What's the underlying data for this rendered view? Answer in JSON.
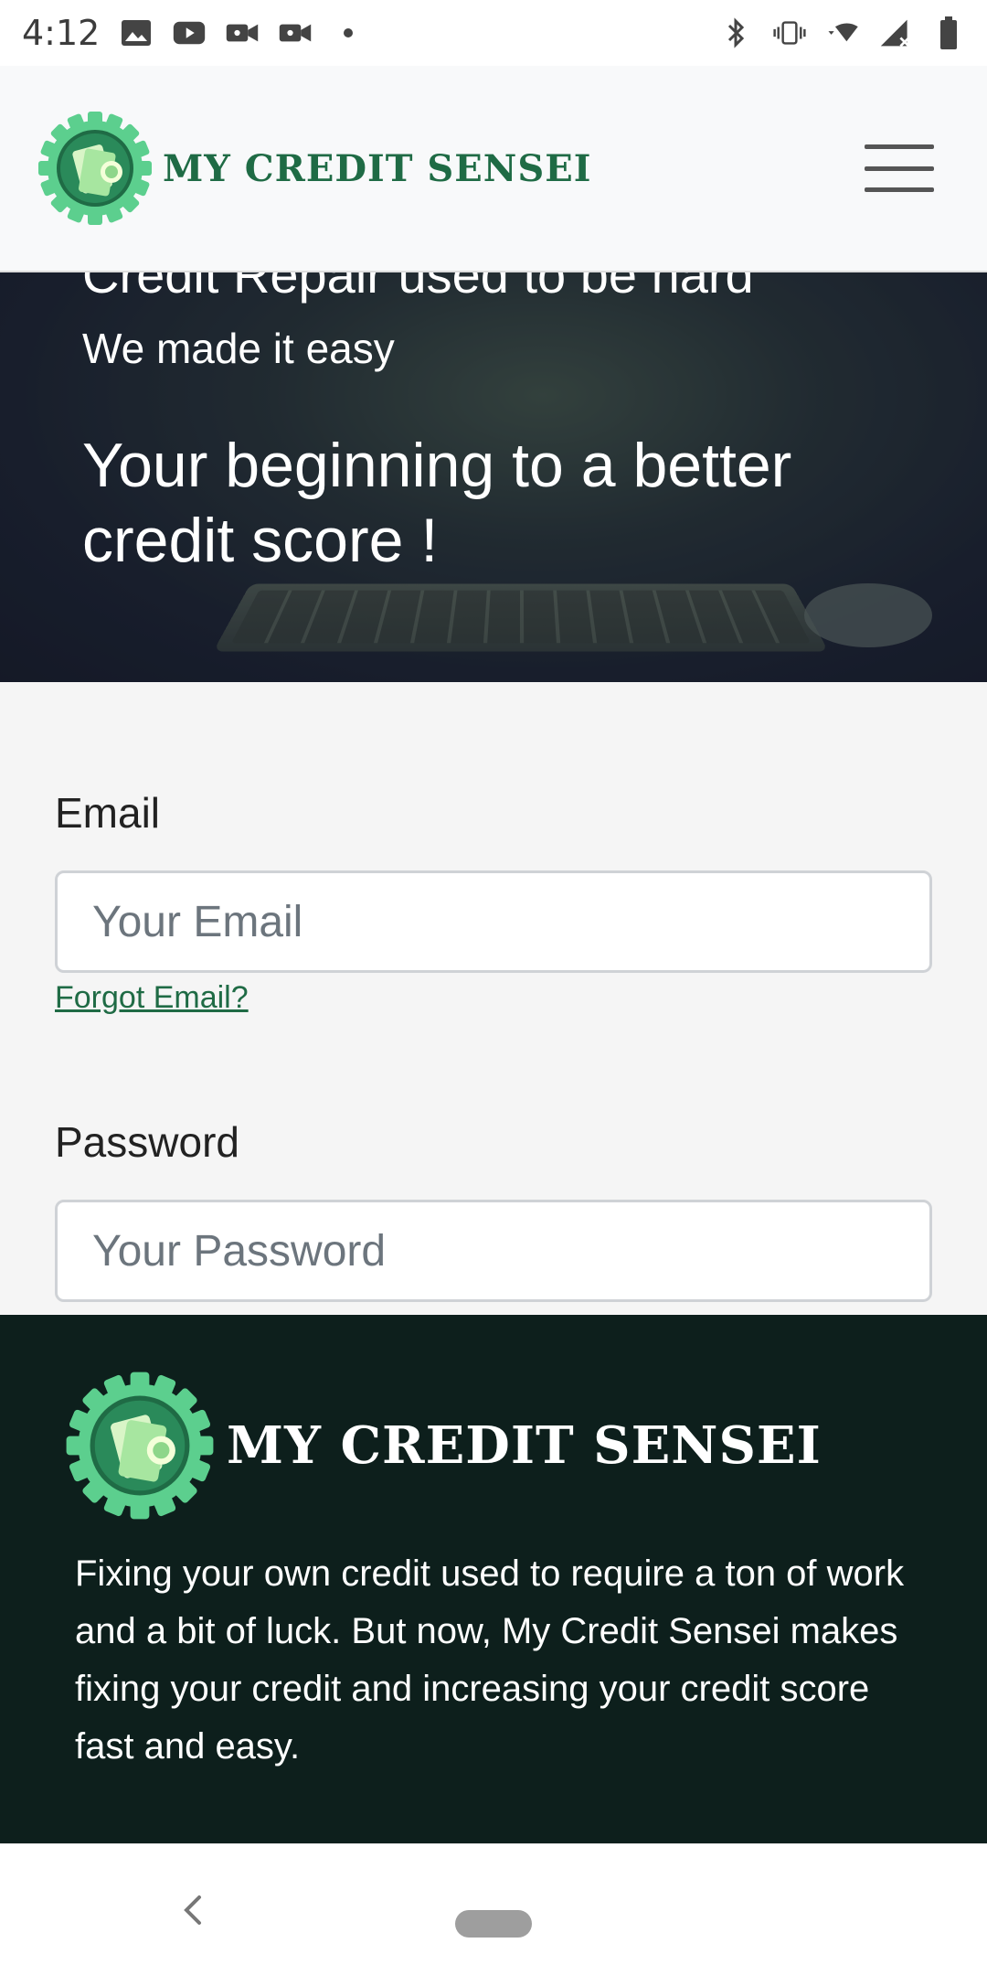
{
  "status_bar": {
    "time": "4:12",
    "left_icons": [
      "image-icon",
      "youtube-icon",
      "video-camera-icon",
      "video-camera-icon",
      "dot-icon"
    ],
    "right_icons": [
      "bluetooth-icon",
      "vibrate-icon",
      "wifi-icon",
      "signal-icon",
      "battery-icon"
    ]
  },
  "header": {
    "brand_name": "MY CREDIT SENSEI",
    "logo_icon": "gear-money-logo-icon",
    "menu_icon": "hamburger-menu-icon"
  },
  "hero": {
    "cut_text": "Credit Repair used to be hard",
    "subtitle": "We made it easy",
    "title": "Your beginning to a better credit score !"
  },
  "form": {
    "email_label": "Email",
    "email_placeholder": "Your Email",
    "email_value": "",
    "forgot_email": "Forgot Email?",
    "password_label": "Password",
    "password_placeholder": "Your Password",
    "password_value": ""
  },
  "footer": {
    "brand_name": "MY CREDIT SENSEI",
    "description": "Fixing your own credit used to require a ton of work and a bit of luck. But now, My Credit Sensei makes fixing your credit and increasing your credit score fast and easy."
  },
  "nav_bar": {
    "back_icon": "back-chevron-icon",
    "home_icon": "home-pill-icon"
  },
  "colors": {
    "brand_green": "#1f6b45",
    "logo_green": "#5ccf8e",
    "footer_bg": "#0d1f1c",
    "hero_bg": "#1c2230"
  }
}
